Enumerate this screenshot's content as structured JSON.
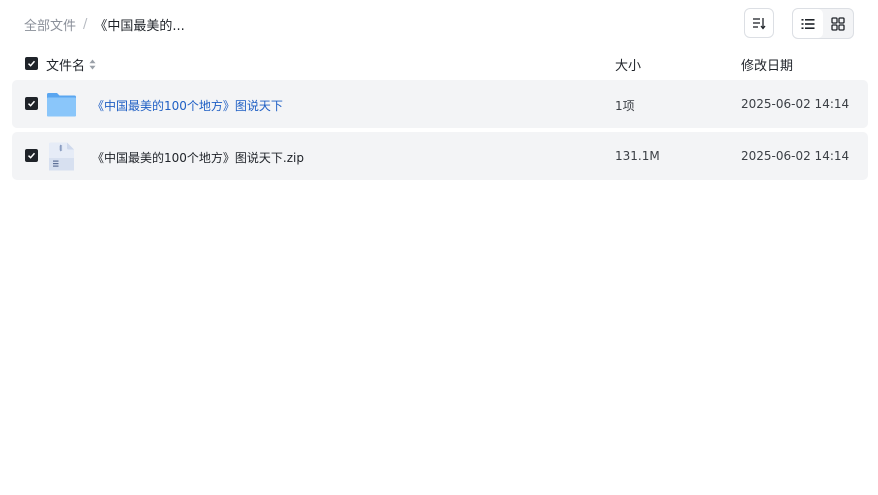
{
  "breadcrumb": {
    "root": "全部文件",
    "separator": "/",
    "current": "《中国最美的..."
  },
  "toolbar": {
    "sort_icon": "sort-lines-icon",
    "view_list_icon": "list-view-icon",
    "view_grid_icon": "grid-view-icon",
    "active_view": "list"
  },
  "table": {
    "columns": {
      "name": "文件名",
      "size": "大小",
      "modified": "修改日期"
    },
    "rows": [
      {
        "type": "folder",
        "icon": "folder-icon",
        "name": "《中国最美的100个地方》图说天下",
        "size": "1项",
        "modified": "2025-06-02 14:14",
        "checked": true
      },
      {
        "type": "file",
        "icon": "zip-file-icon",
        "name": "《中国最美的100个地方》图说天下.zip",
        "size": "131.1M",
        "modified": "2025-06-02 14:14",
        "checked": true
      }
    ]
  },
  "colors": {
    "checkbox": "#1f2329",
    "row_background": "#f3f4f6",
    "folder_link": "#1f5fc4",
    "folder_icon": "#6fb6f7",
    "muted_text": "#8a8f99"
  }
}
